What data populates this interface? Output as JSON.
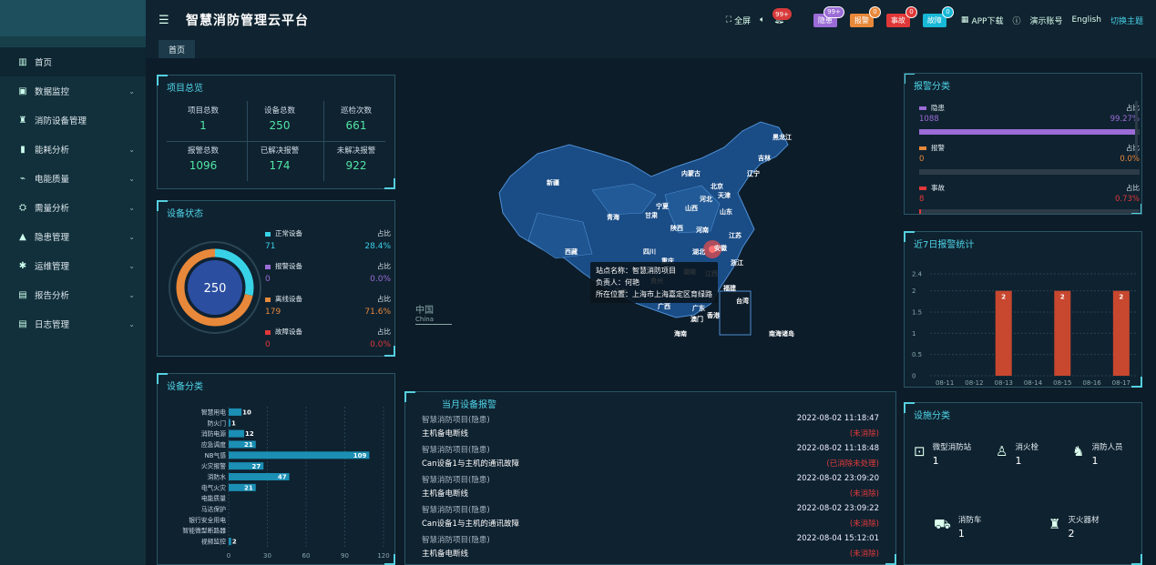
{
  "app": {
    "title": "智慧消防管理云平台"
  },
  "topbar": {
    "fullscreen": "全屏",
    "bell_badge": "99+",
    "tags": [
      {
        "label": "隐患",
        "badge": "99+",
        "color": "#9b6cd6",
        "badge_color": "#9b6cd6"
      },
      {
        "label": "报警",
        "badge": "0",
        "color": "#e8883a",
        "badge_color": "#e8883a"
      },
      {
        "label": "事故",
        "badge": "0",
        "color": "#e03838",
        "badge_color": "#e03838"
      },
      {
        "label": "故障",
        "badge": "0",
        "color": "#17b8d6",
        "badge_color": "#17b8d6"
      }
    ],
    "app_download": "APP下载",
    "demo_account": "演示账号",
    "language": "English",
    "switch_theme": "切换主题"
  },
  "tabs": [
    {
      "label": "首页"
    }
  ],
  "sidebar": {
    "items": [
      {
        "label": "首页",
        "icon": "home-icon",
        "has_children": false
      },
      {
        "label": "数据监控",
        "icon": "monitor-icon",
        "has_children": true
      },
      {
        "label": "消防设备管理",
        "icon": "extinguisher-icon",
        "has_children": false
      },
      {
        "label": "能耗分析",
        "icon": "bar-chart-icon",
        "has_children": true
      },
      {
        "label": "电能质量",
        "icon": "power-icon",
        "has_children": true
      },
      {
        "label": "需量分析",
        "icon": "demand-icon",
        "has_children": true
      },
      {
        "label": "隐患管理",
        "icon": "warning-icon",
        "has_children": true
      },
      {
        "label": "运维管理",
        "icon": "maintenance-icon",
        "has_children": true
      },
      {
        "label": "报告分析",
        "icon": "report-icon",
        "has_children": true
      },
      {
        "label": "日志管理",
        "icon": "log-icon",
        "has_children": true
      }
    ]
  },
  "overview": {
    "title": "项目总览",
    "cells": [
      {
        "label": "项目总数",
        "value": "1"
      },
      {
        "label": "设备总数",
        "value": "250"
      },
      {
        "label": "巡检次数",
        "value": "661"
      },
      {
        "label": "报警总数",
        "value": "1096"
      },
      {
        "label": "已解决报警",
        "value": "174"
      },
      {
        "label": "未解决报警",
        "value": "922"
      }
    ]
  },
  "device_status": {
    "title": "设备状态",
    "total": "250",
    "ratio_label": "占比",
    "items": [
      {
        "label": "正常设备",
        "value": "71",
        "pct": "28.4%",
        "color": "#38d2e6",
        "fraction": 0.284
      },
      {
        "label": "报警设备",
        "value": "0",
        "pct": "0.0%",
        "color": "#9b6cd6",
        "fraction": 0.0
      },
      {
        "label": "离线设备",
        "value": "179",
        "pct": "71.6%",
        "color": "#e8883a",
        "fraction": 0.716
      },
      {
        "label": "故障设备",
        "value": "0",
        "pct": "0.0%",
        "color": "#e03838",
        "fraction": 0.0
      }
    ]
  },
  "alarm_classification": {
    "title": "报警分类",
    "ratio_label": "占比",
    "items": [
      {
        "label": "隐患",
        "value": "1088",
        "pct": "99.27%",
        "color": "#9b6cd6",
        "fraction": 0.9927
      },
      {
        "label": "报警",
        "value": "0",
        "pct": "0.0%",
        "color": "#e8883a",
        "fraction": 0.0
      },
      {
        "label": "事故",
        "value": "8",
        "pct": "0.73%",
        "color": "#e03838",
        "fraction": 0.0073
      }
    ]
  },
  "map": {
    "labels": [
      "新疆",
      "西藏",
      "青海",
      "甘肃",
      "宁夏",
      "内蒙古",
      "黑龙江",
      "吉林",
      "辽宁",
      "北京",
      "天津",
      "河北",
      "山西",
      "山东",
      "陕西",
      "河南",
      "江苏",
      "安徽",
      "湖北",
      "四川",
      "重庆",
      "贵州",
      "湖南",
      "江西",
      "浙江",
      "福建",
      "广西",
      "广东",
      "香港",
      "澳门",
      "海南",
      "云南",
      "台湾",
      "南海诸岛"
    ],
    "china_label": "中国",
    "china_label_en": "China",
    "tooltip": {
      "station": "站点名称：智慧消防项目",
      "person": "负责人：何艳",
      "location": "所在位置：上海市上海嘉定区育绿路"
    }
  },
  "weekly_alarms": {
    "title": "近7日报警统计",
    "chart_data": {
      "type": "bar",
      "categories": [
        "08-11",
        "08-12",
        "08-13",
        "08-14",
        "08-15",
        "08-16",
        "08-17"
      ],
      "values": [
        0,
        0,
        2,
        0,
        2,
        0,
        2
      ],
      "ylim": [
        0,
        2.4
      ],
      "yticks": [
        "0",
        "0.5",
        "1",
        "1.5",
        "2",
        "2.4"
      ],
      "color": "#c8472f"
    }
  },
  "device_classification": {
    "title": "设备分类",
    "chart_data": {
      "type": "bar",
      "orientation": "horizontal",
      "categories": [
        "智慧用电",
        "防火门",
        "消防电源",
        "应急调度",
        "NB气感",
        "火灾报警",
        "消防水",
        "电气火灾",
        "电能质量",
        "马达保护",
        "银行安全用电",
        "智能微型断路器",
        "视频监控"
      ],
      "values": [
        10,
        1,
        12,
        21,
        109,
        27,
        47,
        21,
        0,
        0,
        0,
        0,
        2
      ],
      "xlim": [
        0,
        120
      ],
      "xticks": [
        "0",
        "30",
        "60",
        "90",
        "120"
      ],
      "color": "#1b8fb4"
    }
  },
  "monthly_alarms": {
    "title": "当月设备报警",
    "items": [
      {
        "project": "智慧消防项目(隐患)",
        "time": "2022-08-02 11:18:47",
        "desc": "主机备电断线",
        "status": "(未消除)"
      },
      {
        "project": "智慧消防项目(隐患)",
        "time": "2022-08-02 11:18:48",
        "desc": "Can设备1与主机的通讯故障",
        "status": "(已消除未处理)"
      },
      {
        "project": "智慧消防项目(隐患)",
        "time": "2022-08-02 23:09:20",
        "desc": "主机备电断线",
        "status": "(未消除)"
      },
      {
        "project": "智慧消防项目(隐患)",
        "time": "2022-08-02 23:09:22",
        "desc": "Can设备1与主机的通讯故障",
        "status": "(未消除)"
      },
      {
        "project": "智慧消防项目(隐患)",
        "time": "2022-08-04 15:12:01",
        "desc": "主机备电断线",
        "status": "(未消除)"
      }
    ]
  },
  "facilities": {
    "title": "设施分类",
    "items": [
      {
        "name": "微型消防站",
        "value": "1",
        "icon": "fire-station-icon"
      },
      {
        "name": "消火栓",
        "value": "1",
        "icon": "hydrant-icon"
      },
      {
        "name": "消防人员",
        "value": "1",
        "icon": "firefighter-icon"
      },
      {
        "name": "消防车",
        "value": "1",
        "icon": "fire-truck-icon"
      },
      {
        "name": "灭火器材",
        "value": "2",
        "icon": "extinguisher-icon"
      }
    ]
  }
}
